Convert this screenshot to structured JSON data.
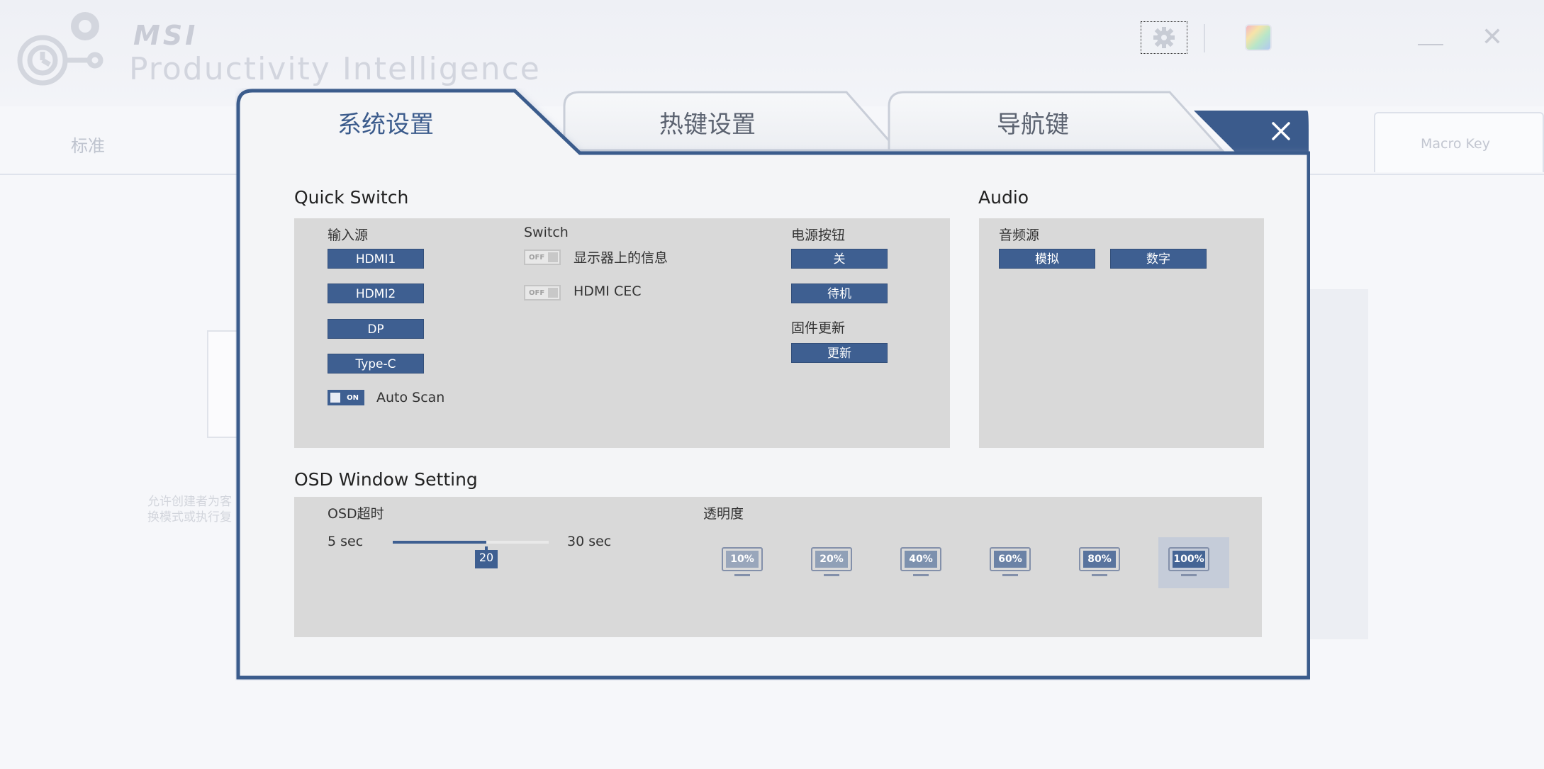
{
  "app": {
    "brand": "MSI",
    "product": "Productivity Intelligence",
    "tab_standard": "标准",
    "tab_macro": "Macro Key",
    "description_line1": "允许创建者为客",
    "description_line2": "换模式或执行复"
  },
  "dialog": {
    "tabs": [
      {
        "label": "系统设置",
        "active": true
      },
      {
        "label": "热键设置",
        "active": false
      },
      {
        "label": "导航键",
        "active": false
      }
    ],
    "quick_switch": {
      "title": "Quick Switch",
      "input_source": {
        "label": "输入源",
        "buttons": [
          "HDMI1",
          "HDMI2",
          "DP",
          "Type-C"
        ],
        "auto_scan": {
          "label": "Auto Scan",
          "state": "ON"
        }
      },
      "switch": {
        "label": "Switch",
        "items": [
          {
            "label": "显示器上的信息",
            "state": "OFF"
          },
          {
            "label": "HDMI CEC",
            "state": "OFF"
          }
        ]
      },
      "power": {
        "label": "电源按钮",
        "buttons": [
          "关",
          "待机"
        ]
      },
      "firmware": {
        "label": "固件更新",
        "button": "更新"
      }
    },
    "audio": {
      "title": "Audio",
      "source_label": "音频源",
      "buttons": [
        "模拟",
        "数字"
      ]
    },
    "osd": {
      "title": "OSD Window Setting",
      "timeout": {
        "label": "OSD超时",
        "min_label": "5 sec",
        "max_label": "30 sec",
        "value": "20",
        "fill_fraction": 0.6
      },
      "transparency": {
        "label": "透明度",
        "options": [
          "10%",
          "20%",
          "40%",
          "60%",
          "80%",
          "100%"
        ],
        "selected": "100%"
      }
    }
  },
  "colors": {
    "accent": "#3e5f91",
    "panel": "#d9d9d9",
    "dialog_border": "#3b5b8c"
  }
}
